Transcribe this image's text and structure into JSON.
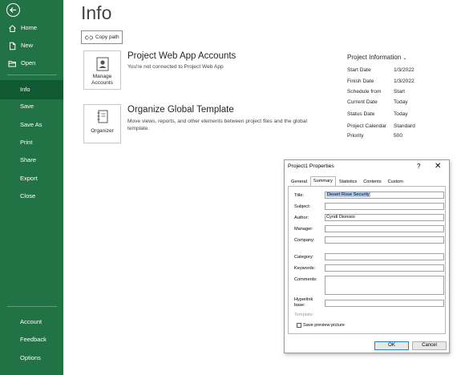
{
  "sidebar": {
    "back_icon": "back-arrow-icon",
    "top_items": [
      {
        "label": "Home",
        "icon": "home-icon"
      },
      {
        "label": "New",
        "icon": "new-document-icon"
      },
      {
        "label": "Open",
        "icon": "open-folder-icon"
      }
    ],
    "mid_items": [
      "Info",
      "Save",
      "Save As",
      "Print",
      "Share",
      "Export",
      "Close"
    ],
    "active_item": "Info",
    "bottom_items": [
      "Account",
      "Feedback",
      "Options"
    ],
    "color": "#217346",
    "active_color": "#0f5a32"
  },
  "main": {
    "title": "Info",
    "copy_path_label": "Copy path",
    "pwa": {
      "button_label_line1": "Manage",
      "button_label_line2": "Accounts",
      "title": "Project Web App Accounts",
      "desc": "You're not connected to Project Web App"
    },
    "organizer": {
      "button_label": "Organizer",
      "title": "Organize Global Template",
      "desc_line1": "Move views, reports, and other elements between project files and the global",
      "desc_line2": "template."
    },
    "project_info": {
      "heading": "Project Information",
      "rows": [
        {
          "label": "Start Date",
          "value": "1/3/2022"
        },
        {
          "label": "Finish Date",
          "value": "1/3/2022"
        },
        {
          "label": "Schedule from",
          "value": "Start"
        },
        {
          "label": "Current Date",
          "value": "Today"
        },
        {
          "label": "Status Date",
          "value": "Today"
        },
        {
          "label": "Project Calendar",
          "value": "Standard"
        },
        {
          "label": "Priority",
          "value": "500"
        }
      ]
    }
  },
  "dialog": {
    "title": "Project1 Properties",
    "help": "?",
    "close": "✕",
    "tabs": [
      "General",
      "Summary",
      "Statistics",
      "Contents",
      "Custom"
    ],
    "active_tab": "Summary",
    "fields": {
      "title_label": "Title:",
      "title_value": "Desert Rose Security",
      "subject_label": "Subject:",
      "subject_value": "",
      "author_label": "Author:",
      "author_value": "Cyndi Dionisio",
      "manager_label": "Manager:",
      "manager_value": "",
      "company_label": "Company:",
      "company_value": "",
      "category_label": "Category:",
      "category_value": "",
      "keywords_label": "Keywords:",
      "keywords_value": "",
      "comments_label": "Comments:",
      "comments_value": "",
      "hyperlink_label_line1": "Hyperlink",
      "hyperlink_label_line2": "base:",
      "hyperlink_value": "",
      "template_label": "Template:"
    },
    "save_preview_label": "Save preview picture",
    "ok_label": "OK",
    "cancel_label": "Cancel",
    "selection_color": "#aecbf0"
  }
}
